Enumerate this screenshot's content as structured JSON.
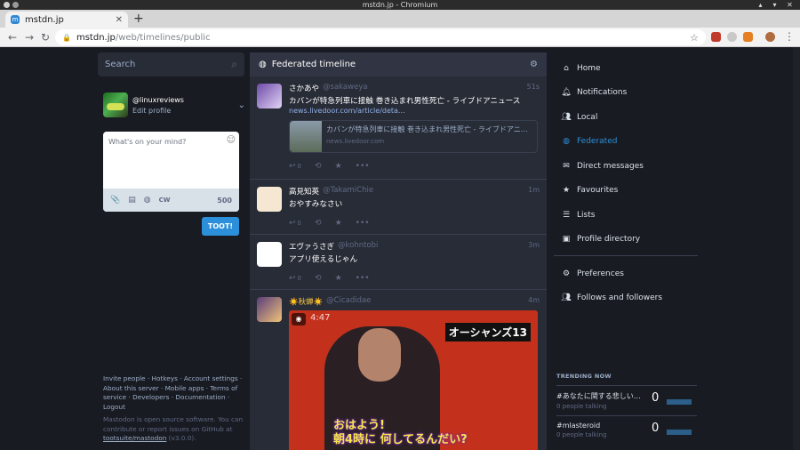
{
  "os": {
    "window_title": "mstdn.jp - Chromium"
  },
  "browser": {
    "tab_title": "mstdn.jp",
    "url_domain": "mstdn.jp",
    "url_path": "/web/timelines/public"
  },
  "left": {
    "search_placeholder": "Search",
    "account_handle": "@linuxreviews",
    "edit_profile": "Edit profile",
    "compose_placeholder": "What's on your mind?",
    "cw_label": "CW",
    "char_count": "500",
    "toot_button": "TOOT!",
    "footer_links": "Invite people · Hotkeys · Account settings · About this server · Mobile apps · Terms of service · Developers · Documentation · Logout",
    "footer_about_1": "Mastodon is open source software. You can contribute or report issues on GitHub at",
    "footer_repo": "tootsuite/mastodon",
    "footer_version": "(v3.0.0)."
  },
  "timeline": {
    "title": "Federated timeline",
    "statuses": [
      {
        "name": "さかあや",
        "handle": "@sakaweya",
        "time": "51s",
        "text": "カバンが特急列車に接触 巻き込まれ男性死亡 - ライブドアニュース",
        "link": "news.livedoor.com/article/deta…",
        "card_title": "カバンが特急列車に接触 巻き込まれ男性死亡 - ライブドアニュ…",
        "card_domain": "news.livedoor.com",
        "replies": "0"
      },
      {
        "name": "高見知英",
        "handle": "@TakamiChie",
        "time": "1m",
        "text": "おやすみなさい",
        "replies": "0"
      },
      {
        "name": "エヴァうさぎ",
        "handle": "@kohntobi",
        "time": "3m",
        "text": "アプリ使えるじゃん",
        "replies": "0"
      },
      {
        "name": "☀️秋蝉☀️",
        "handle": "@Cicadidae",
        "time": "4m",
        "media_title": "オーシャンズ13",
        "media_clock": "4:47",
        "media_sub_1": "おはよう!",
        "media_sub_2": "朝4時に 何してるんだい?"
      }
    ]
  },
  "nav": {
    "items": [
      "Home",
      "Notifications",
      "Local",
      "Federated",
      "Direct messages",
      "Favourites",
      "Lists",
      "Profile directory"
    ],
    "items2": [
      "Preferences",
      "Follows and followers"
    ]
  },
  "trending": {
    "title": "TRENDING NOW",
    "items": [
      {
        "tag": "#あなたに関する悲しいお…",
        "people": "0 people talking",
        "count": "0"
      },
      {
        "tag": "#mlasteroid",
        "people": "0 people talking",
        "count": "0"
      }
    ]
  },
  "colors": {
    "accent": "#2b90d9",
    "bg": "#191b22",
    "column": "#282c37"
  }
}
